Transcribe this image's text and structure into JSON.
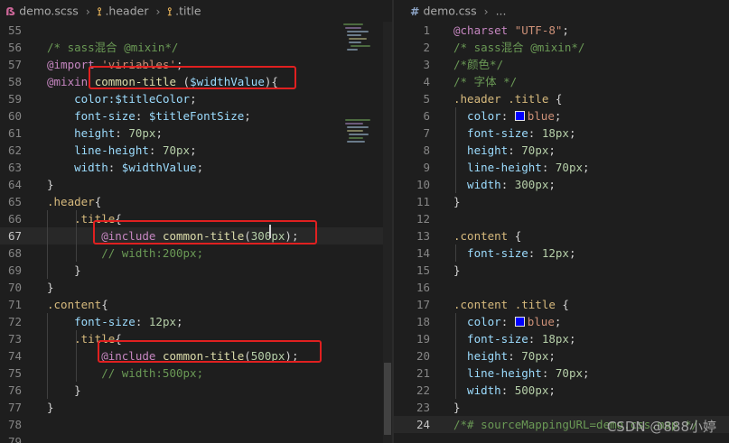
{
  "left_editor": {
    "breadcrumb": {
      "file": "demo.scss",
      "item1": ".header",
      "item2": ".title"
    },
    "lines": [
      {
        "n": "55",
        "tokens": []
      },
      {
        "n": "56",
        "tokens": [
          {
            "t": "/* sass混合 @mixin*/",
            "c": "c-com"
          }
        ]
      },
      {
        "n": "57",
        "tokens": [
          {
            "t": "@import ",
            "c": "c-at"
          },
          {
            "t": "'viriables'",
            "c": "c-str"
          },
          {
            "t": ";",
            "c": "c-txt"
          }
        ]
      },
      {
        "n": "58",
        "tokens": [
          {
            "t": "@mixin ",
            "c": "c-at"
          },
          {
            "t": "common-title",
            "c": "c-fn"
          },
          {
            "t": " (",
            "c": "c-txt"
          },
          {
            "t": "$widthValue",
            "c": "c-var"
          },
          {
            "t": "){",
            "c": "c-txt"
          }
        ]
      },
      {
        "n": "59",
        "tokens": [
          {
            "t": "    color:",
            "c": "c-prop"
          },
          {
            "t": "$titleColor",
            "c": "c-var"
          },
          {
            "t": ";",
            "c": "c-txt"
          }
        ]
      },
      {
        "n": "60",
        "tokens": [
          {
            "t": "    font-size",
            "c": "c-prop"
          },
          {
            "t": ": ",
            "c": "c-txt"
          },
          {
            "t": "$titleFontSize",
            "c": "c-var"
          },
          {
            "t": ";",
            "c": "c-txt"
          }
        ]
      },
      {
        "n": "61",
        "tokens": [
          {
            "t": "    height",
            "c": "c-prop"
          },
          {
            "t": ": ",
            "c": "c-txt"
          },
          {
            "t": "70px",
            "c": "c-num"
          },
          {
            "t": ";",
            "c": "c-txt"
          }
        ]
      },
      {
        "n": "62",
        "tokens": [
          {
            "t": "    line-height",
            "c": "c-prop"
          },
          {
            "t": ": ",
            "c": "c-txt"
          },
          {
            "t": "70px",
            "c": "c-num"
          },
          {
            "t": ";",
            "c": "c-txt"
          }
        ]
      },
      {
        "n": "63",
        "tokens": [
          {
            "t": "    width",
            "c": "c-prop"
          },
          {
            "t": ": ",
            "c": "c-txt"
          },
          {
            "t": "$widthValue",
            "c": "c-var"
          },
          {
            "t": ";",
            "c": "c-txt"
          }
        ]
      },
      {
        "n": "64",
        "tokens": [
          {
            "t": "}",
            "c": "c-txt"
          }
        ]
      },
      {
        "n": "65",
        "tokens": [
          {
            "t": ".header",
            "c": "c-sel"
          },
          {
            "t": "{",
            "c": "c-txt"
          }
        ]
      },
      {
        "n": "66",
        "tokens": [
          {
            "t": "    .title",
            "c": "c-sel"
          },
          {
            "t": "{",
            "c": "c-txt"
          }
        ]
      },
      {
        "n": "67",
        "tokens": [
          {
            "t": "        @include ",
            "c": "c-at"
          },
          {
            "t": "common-title",
            "c": "c-fn"
          },
          {
            "t": "(",
            "c": "c-txt"
          },
          {
            "t": "300px",
            "c": "c-num"
          },
          {
            "t": ");",
            "c": "c-txt"
          }
        ]
      },
      {
        "n": "68",
        "tokens": [
          {
            "t": "        // width:200px;",
            "c": "c-com"
          }
        ]
      },
      {
        "n": "69",
        "tokens": [
          {
            "t": "    }",
            "c": "c-txt"
          }
        ]
      },
      {
        "n": "70",
        "tokens": [
          {
            "t": "}",
            "c": "c-txt"
          }
        ]
      },
      {
        "n": "71",
        "tokens": [
          {
            "t": ".content",
            "c": "c-sel"
          },
          {
            "t": "{",
            "c": "c-txt"
          }
        ]
      },
      {
        "n": "72",
        "tokens": [
          {
            "t": "    font-size",
            "c": "c-prop"
          },
          {
            "t": ": ",
            "c": "c-txt"
          },
          {
            "t": "12px",
            "c": "c-num"
          },
          {
            "t": ";",
            "c": "c-txt"
          }
        ]
      },
      {
        "n": "73",
        "tokens": [
          {
            "t": "    .title",
            "c": "c-sel"
          },
          {
            "t": "{",
            "c": "c-txt"
          }
        ]
      },
      {
        "n": "74",
        "tokens": [
          {
            "t": "        @include ",
            "c": "c-at"
          },
          {
            "t": "common-title",
            "c": "c-fn"
          },
          {
            "t": "(",
            "c": "c-txt"
          },
          {
            "t": "500px",
            "c": "c-num"
          },
          {
            "t": ");",
            "c": "c-txt"
          }
        ]
      },
      {
        "n": "75",
        "tokens": [
          {
            "t": "        // width:500px;",
            "c": "c-com"
          }
        ]
      },
      {
        "n": "76",
        "tokens": [
          {
            "t": "    }",
            "c": "c-txt"
          }
        ]
      },
      {
        "n": "77",
        "tokens": [
          {
            "t": "}",
            "c": "c-txt"
          }
        ]
      },
      {
        "n": "78",
        "tokens": []
      },
      {
        "n": "79",
        "tokens": []
      }
    ]
  },
  "right_editor": {
    "breadcrumb": {
      "file": "demo.css",
      "item1": "..."
    },
    "lines": [
      {
        "n": "1",
        "tokens": [
          {
            "t": "@charset ",
            "c": "c-at"
          },
          {
            "t": "\"UTF-8\"",
            "c": "c-str"
          },
          {
            "t": ";",
            "c": "c-txt"
          }
        ]
      },
      {
        "n": "2",
        "tokens": [
          {
            "t": "/* sass混合 @mixin*/",
            "c": "c-com"
          }
        ]
      },
      {
        "n": "3",
        "tokens": [
          {
            "t": "/*颜色*/",
            "c": "c-com"
          }
        ]
      },
      {
        "n": "4",
        "tokens": [
          {
            "t": "/* 字体 */",
            "c": "c-com"
          }
        ]
      },
      {
        "n": "5",
        "tokens": [
          {
            "t": ".header .title",
            "c": "c-sel"
          },
          {
            "t": " {",
            "c": "c-txt"
          }
        ]
      },
      {
        "n": "6",
        "tokens": [
          {
            "t": "  color",
            "c": "c-prop"
          },
          {
            "t": ": ",
            "c": "c-txt"
          },
          {
            "t": "■",
            "c": "swatch"
          },
          {
            "t": "blue",
            "c": "c-str"
          },
          {
            "t": ";",
            "c": "c-txt"
          }
        ]
      },
      {
        "n": "7",
        "tokens": [
          {
            "t": "  font-size",
            "c": "c-prop"
          },
          {
            "t": ": ",
            "c": "c-txt"
          },
          {
            "t": "18px",
            "c": "c-num"
          },
          {
            "t": ";",
            "c": "c-txt"
          }
        ]
      },
      {
        "n": "8",
        "tokens": [
          {
            "t": "  height",
            "c": "c-prop"
          },
          {
            "t": ": ",
            "c": "c-txt"
          },
          {
            "t": "70px",
            "c": "c-num"
          },
          {
            "t": ";",
            "c": "c-txt"
          }
        ]
      },
      {
        "n": "9",
        "tokens": [
          {
            "t": "  line-height",
            "c": "c-prop"
          },
          {
            "t": ": ",
            "c": "c-txt"
          },
          {
            "t": "70px",
            "c": "c-num"
          },
          {
            "t": ";",
            "c": "c-txt"
          }
        ]
      },
      {
        "n": "10",
        "tokens": [
          {
            "t": "  width",
            "c": "c-prop"
          },
          {
            "t": ": ",
            "c": "c-txt"
          },
          {
            "t": "300px",
            "c": "c-num"
          },
          {
            "t": ";",
            "c": "c-txt"
          }
        ]
      },
      {
        "n": "11",
        "tokens": [
          {
            "t": "}",
            "c": "c-txt"
          }
        ]
      },
      {
        "n": "12",
        "tokens": []
      },
      {
        "n": "13",
        "tokens": [
          {
            "t": ".content",
            "c": "c-sel"
          },
          {
            "t": " {",
            "c": "c-txt"
          }
        ]
      },
      {
        "n": "14",
        "tokens": [
          {
            "t": "  font-size",
            "c": "c-prop"
          },
          {
            "t": ": ",
            "c": "c-txt"
          },
          {
            "t": "12px",
            "c": "c-num"
          },
          {
            "t": ";",
            "c": "c-txt"
          }
        ]
      },
      {
        "n": "15",
        "tokens": [
          {
            "t": "}",
            "c": "c-txt"
          }
        ]
      },
      {
        "n": "16",
        "tokens": []
      },
      {
        "n": "17",
        "tokens": [
          {
            "t": ".content .title",
            "c": "c-sel"
          },
          {
            "t": " {",
            "c": "c-txt"
          }
        ]
      },
      {
        "n": "18",
        "tokens": [
          {
            "t": "  color",
            "c": "c-prop"
          },
          {
            "t": ": ",
            "c": "c-txt"
          },
          {
            "t": "■",
            "c": "swatch"
          },
          {
            "t": "blue",
            "c": "c-str"
          },
          {
            "t": ";",
            "c": "c-txt"
          }
        ]
      },
      {
        "n": "19",
        "tokens": [
          {
            "t": "  font-size",
            "c": "c-prop"
          },
          {
            "t": ": ",
            "c": "c-txt"
          },
          {
            "t": "18px",
            "c": "c-num"
          },
          {
            "t": ";",
            "c": "c-txt"
          }
        ]
      },
      {
        "n": "20",
        "tokens": [
          {
            "t": "  height",
            "c": "c-prop"
          },
          {
            "t": ": ",
            "c": "c-txt"
          },
          {
            "t": "70px",
            "c": "c-num"
          },
          {
            "t": ";",
            "c": "c-txt"
          }
        ]
      },
      {
        "n": "21",
        "tokens": [
          {
            "t": "  line-height",
            "c": "c-prop"
          },
          {
            "t": ": ",
            "c": "c-txt"
          },
          {
            "t": "70px",
            "c": "c-num"
          },
          {
            "t": ";",
            "c": "c-txt"
          }
        ]
      },
      {
        "n": "22",
        "tokens": [
          {
            "t": "  width",
            "c": "c-prop"
          },
          {
            "t": ": ",
            "c": "c-txt"
          },
          {
            "t": "500px",
            "c": "c-num"
          },
          {
            "t": ";",
            "c": "c-txt"
          }
        ]
      },
      {
        "n": "23",
        "tokens": [
          {
            "t": "}",
            "c": "c-txt"
          }
        ]
      },
      {
        "n": "24",
        "tokens": [
          {
            "t": "/*# sourceMappingURL=demo.css.map */",
            "c": "c-com"
          }
        ]
      }
    ]
  },
  "watermark": "CSDN @888小婷",
  "colors": {
    "highlight_box": "#e02020",
    "swatch_blue": "#0000ff"
  }
}
